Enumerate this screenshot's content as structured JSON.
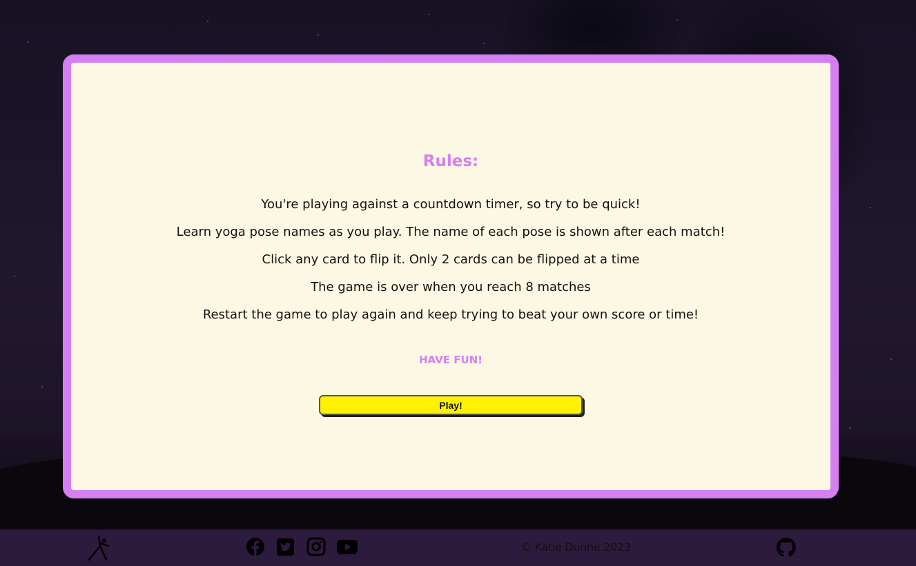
{
  "colors": {
    "accent": "#d580f2",
    "modal_bg": "#fdf8e3",
    "play_button": "#fff200",
    "footer_bg": "#2d1b3d"
  },
  "rules": {
    "title": "Rules:",
    "items": [
      "You're playing against a countdown timer, so try to be quick!",
      "Learn yoga pose names as you play. The name of each pose is shown after each match!",
      "Click any card to flip it. Only 2 cards can be flipped at a time",
      "The game is over when you reach 8 matches",
      "Restart the game to play again and keep trying to beat your own score or time!"
    ],
    "have_fun": "HAVE FUN!",
    "play_label": "Play!"
  },
  "footer": {
    "logo_icon": "yoga-pose-icon",
    "social_icons": [
      "facebook-icon",
      "twitter-icon",
      "instagram-icon",
      "youtube-icon"
    ],
    "copyright": "© Katie Dunne 2023",
    "github_icon": "github-icon"
  }
}
